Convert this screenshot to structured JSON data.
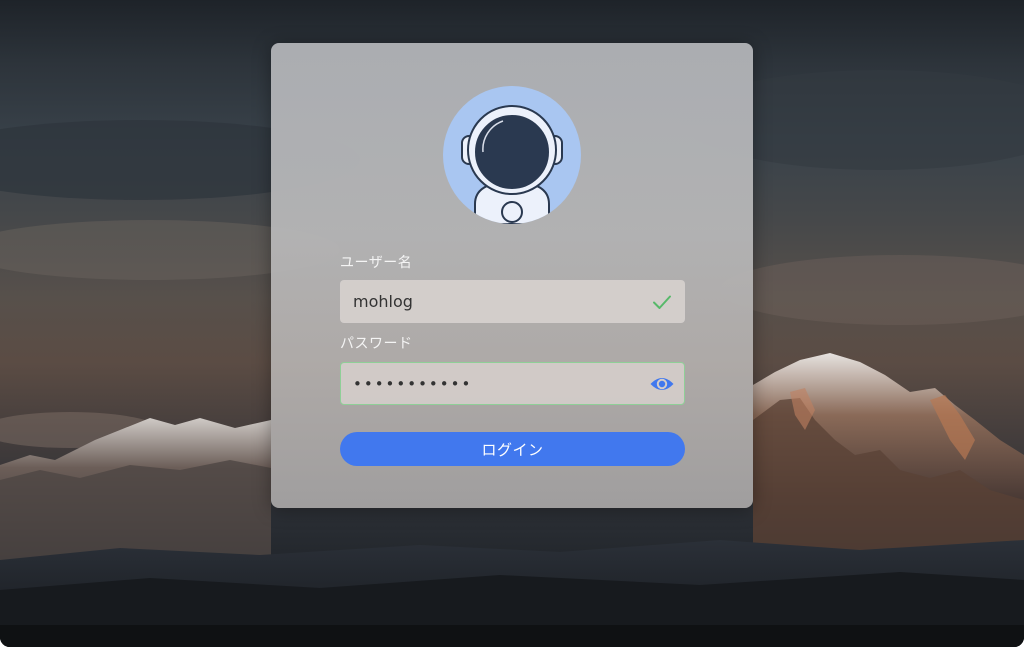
{
  "form": {
    "username": {
      "label": "ユーザー名",
      "value": "mohlog",
      "status_icon": "check-icon"
    },
    "password": {
      "label": "パスワード",
      "value": "•••••••••••",
      "toggle_icon": "eye-icon"
    },
    "login_label": "ログイン"
  },
  "avatar": {
    "icon": "astronaut-icon"
  },
  "colors": {
    "accent": "#4178ee",
    "valid": "#57b96a",
    "avatar_bg": "#a9c6f1",
    "avatar_dark": "#2a3950"
  }
}
